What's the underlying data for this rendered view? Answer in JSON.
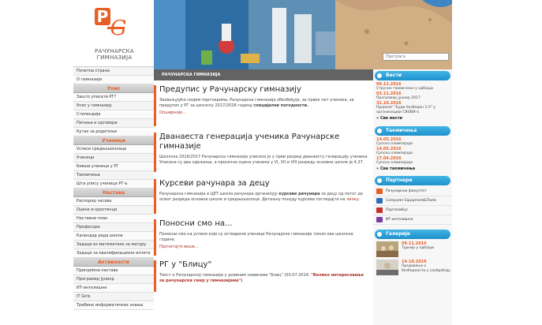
{
  "school_name": "РАЧУНАРСКА ГИМНАЗИЈА",
  "search_placeholder": "Претрага",
  "breadcrumb": "РАЧУНАРСКА ГИМНАЗИЈА",
  "nav": [
    {
      "type": "item",
      "label": "Почетна страна"
    },
    {
      "type": "item",
      "label": "О гимназији"
    },
    {
      "type": "head",
      "label": "Упис"
    },
    {
      "type": "item",
      "label": "Зашто уписати РГ?"
    },
    {
      "type": "item",
      "label": "Упис у гимназију"
    },
    {
      "type": "item",
      "label": "Стипендије"
    },
    {
      "type": "item",
      "label": "Питања и одговори"
    },
    {
      "type": "item",
      "label": "Кутак за родитеље"
    },
    {
      "type": "head",
      "label": "Ученици"
    },
    {
      "type": "item",
      "label": "Успеси средњошколаца"
    },
    {
      "type": "item",
      "label": "Ученици"
    },
    {
      "type": "item",
      "label": "Бивши ученици у РГ"
    },
    {
      "type": "item",
      "label": "Такмичења"
    },
    {
      "type": "item",
      "label": "Шта упису ученици РГ-а"
    },
    {
      "type": "head",
      "label": "Настава"
    },
    {
      "type": "item",
      "label": "Распоред часова"
    },
    {
      "type": "item",
      "label": "Оцене и кростенци"
    },
    {
      "type": "item",
      "label": "Наставни план"
    },
    {
      "type": "item",
      "label": "Професори"
    },
    {
      "type": "item",
      "label": "Календар рада школе"
    },
    {
      "type": "item",
      "label": "Задаци из математике за матуру"
    },
    {
      "type": "item",
      "label": "Задаци за квалификационе испите"
    },
    {
      "type": "head",
      "label": "Активности"
    },
    {
      "type": "item",
      "label": "Припремна настава"
    },
    {
      "type": "item",
      "label": "Програмер Јуниор"
    },
    {
      "type": "item",
      "label": "ИТ-интелишне"
    },
    {
      "type": "item",
      "label": "IT Girls"
    },
    {
      "type": "item",
      "label": "Трибине информатичких знања"
    }
  ],
  "articles": [
    {
      "title": "Предупис у Рачунарску гимназију",
      "text": "Захваљујући својим партнерима, Рачунарска гимназија обезбеђује, за првих пет ученика, за предупис у РГ за школску 2017/2018 годину",
      "emph": "специјалне погодности.",
      "more": "Опширније..."
    },
    {
      "title": "Дванаеста генерација ученика Рачунарске гимназије",
      "text": "Школске 2016/2017 Рачунарска гимназија уписала је у први разред дванаесту генерацију ученика. Уписана су два одељења, а просечна оцена ученика у VI, VII и VIII разреду основне школе је 4,37.",
      "emph": "",
      "more": ""
    },
    {
      "title": "Курсеви рачунара за децу",
      "text": "Рачунарска гимназија и ЦЕТ школа рачунара организују",
      "emph": "курсеве рачунара",
      "text2": "за децу од петог до осмог разреда основне школе и средњошколце. Детаљну понуду курсева погледајте на",
      "link": "линку.",
      "more": ""
    },
    {
      "title": "Поносни смо на...",
      "text": "Поносни смо на успехе које су остварили ученици Рачунарске гимназије током ове школске године.",
      "emph": "",
      "more": "Прочитајте више..."
    },
    {
      "title": "РГ у \"Блицу\"",
      "text": "Текст о Рачунарској гимназији у дневним новинама \"Блиц\" (03.07.2014.",
      "emph": "\"Велико интересовање за рачунарски смер у гимназијама\")",
      "more": ""
    }
  ],
  "news": {
    "title": "Вести",
    "items": [
      {
        "date": "09.11.2016",
        "text": "Стручно такмичење у одбојци"
      },
      {
        "date": "03.11.2016",
        "text": "Програмер јуниор 2017"
      },
      {
        "date": "31.10.2016",
        "text": "Пројекат \"Буди безбедан 2.0\" у организацији СВОВИ-а"
      }
    ],
    "all": "» Све вести"
  },
  "competitions": {
    "title": "Такмичења",
    "items": [
      {
        "date": "14.05.2016",
        "text": "Српска олимпијада"
      },
      {
        "date": "14.05.2016",
        "text": "Српска олимпијада"
      },
      {
        "date": "17.04.2016",
        "text": "Српска олимпијада"
      }
    ],
    "all": "» Сва такмичења"
  },
  "partners": {
    "title": "Партнери",
    "items": [
      "Рачунарски факултет",
      "Computer Equipment&Trade",
      "Порталибус",
      "ИТ-интелишне"
    ]
  },
  "gallery": {
    "title": "Галерије",
    "items": [
      {
        "date": "09.11.2016",
        "text": "Турнир у одбојци"
      },
      {
        "date": "14.10.2016",
        "text": "Предавање о безбедности у саобраћају"
      }
    ]
  },
  "colors": {
    "accent": "#e85f26",
    "header_blue": "#1e90cc",
    "crumb": "#636363"
  }
}
